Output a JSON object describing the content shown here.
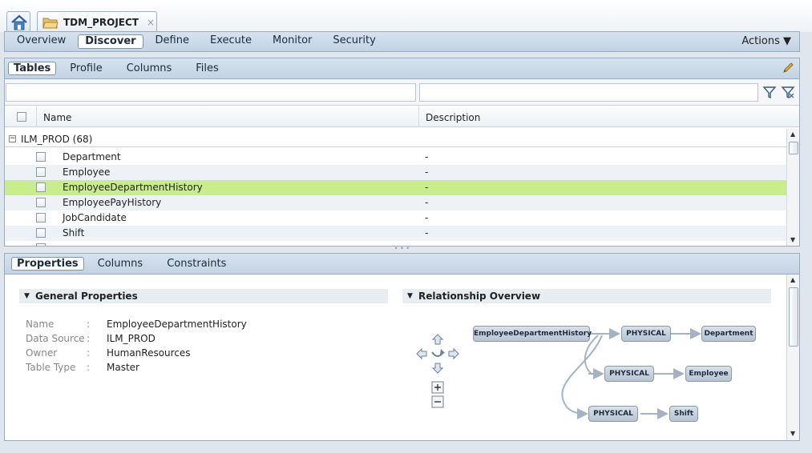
{
  "project_tab": {
    "title": "TDM_PROJECT"
  },
  "main_nav": {
    "items": [
      "Overview",
      "Discover",
      "Define",
      "Execute",
      "Monitor",
      "Security"
    ],
    "active": "Discover",
    "actions_label": "Actions"
  },
  "sub_nav": {
    "items": [
      "Tables",
      "Profile",
      "Columns",
      "Files"
    ],
    "active": "Tables"
  },
  "table": {
    "columns": [
      "Name",
      "Description"
    ],
    "group": {
      "label": "ILM_PROD (68)"
    },
    "rows": [
      {
        "name": "Department",
        "description": "-"
      },
      {
        "name": "Employee",
        "description": "-"
      },
      {
        "name": "EmployeeDepartmentHistory",
        "description": "-"
      },
      {
        "name": "EmployeePayHistory",
        "description": "-"
      },
      {
        "name": "JobCandidate",
        "description": "-"
      },
      {
        "name": "Shift",
        "description": "-"
      }
    ],
    "selected_row": "EmployeeDepartmentHistory"
  },
  "detail_nav": {
    "items": [
      "Properties",
      "Columns",
      "Constraints"
    ],
    "active": "Properties"
  },
  "general_properties": {
    "title": "General Properties",
    "rows": [
      {
        "key": "Name",
        "value": "EmployeeDepartmentHistory"
      },
      {
        "key": "Data Source",
        "value": "ILM_PROD"
      },
      {
        "key": "Owner",
        "value": "HumanResources"
      },
      {
        "key": "Table Type",
        "value": "Master"
      }
    ],
    "separator": ":"
  },
  "relationship_overview": {
    "title": "Relationship Overview",
    "source": "EmployeeDepartmentHistory",
    "relations": [
      {
        "type": "PHYSICAL",
        "target": "Department"
      },
      {
        "type": "PHYSICAL",
        "target": "Employee"
      },
      {
        "type": "PHYSICAL",
        "target": "Shift"
      }
    ]
  },
  "colors": {
    "selected_row": "#c9ec8c",
    "toolbar": "#c4d3e3",
    "border": "#98abc0"
  }
}
